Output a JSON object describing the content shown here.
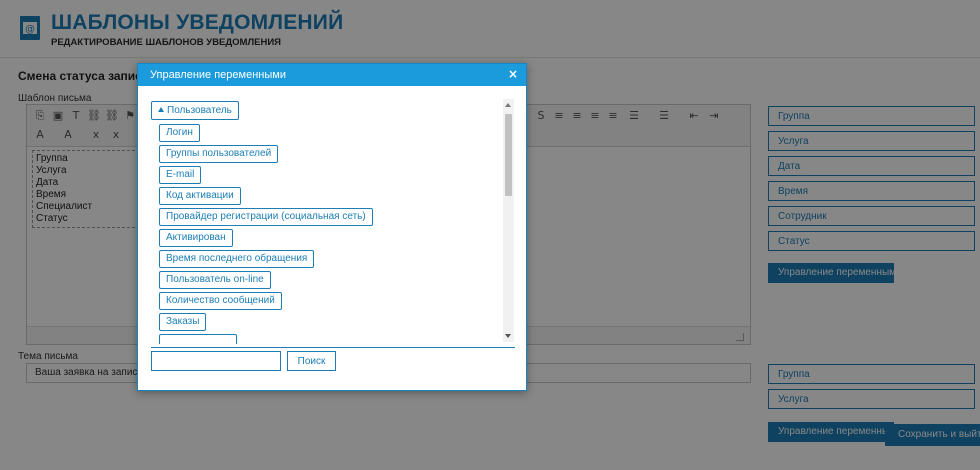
{
  "header": {
    "title": "ШАБЛОНЫ УВЕДОМЛЕНИЙ",
    "subtitle": "РЕДАКТИРОВАНИЕ ШАБЛОНОВ УВЕДОМЛЕНИЯ",
    "icon": "envelope-at-icon"
  },
  "section": {
    "title": "Смена статуса записи",
    "template_label": "Шаблон письма",
    "subject_label": "Тема письма",
    "subject_value": "Ваша заявка на запись \\ %"
  },
  "editor": {
    "variables": [
      "Группа",
      "Услуга",
      "Дата",
      "Время",
      "Специалист",
      "Статус"
    ]
  },
  "side_buttons_top": [
    "Группа",
    "Услуга",
    "Дата",
    "Время",
    "Сотрудник",
    "Статус"
  ],
  "side_primary_label": "Управление переменными",
  "side_buttons_bottom": [
    "Группа",
    "Услуга"
  ],
  "side_primary_bottom_label": "Управление переменными",
  "save_label": "Сохранить и выйти",
  "modal": {
    "title": "Управление переменными",
    "close": "×",
    "root": "Пользователь",
    "items": [
      "Логин",
      "Группы пользователей",
      "E-mail",
      "Код активации",
      "Провайдер регистрации (социальная сеть)",
      "Активирован",
      "Время последнего обращения",
      "Пользователь on-line",
      "Количество сообщений",
      "Заказы"
    ],
    "search_value": "",
    "search_button": "Поиск"
  },
  "colors": {
    "accent": "#1c7eb5",
    "modal_header": "#1b9bdc",
    "overlay": "rgba(0,0,0,0.47)"
  }
}
